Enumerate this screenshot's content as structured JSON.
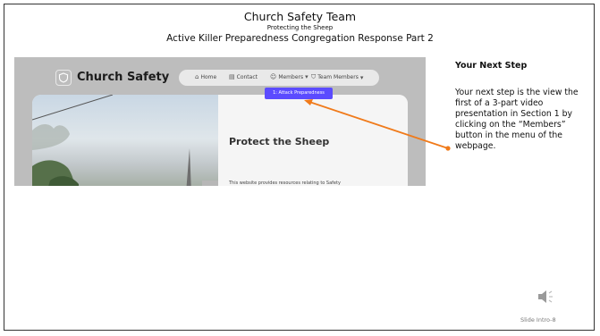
{
  "slide": {
    "title": "Church Safety Team",
    "subtitle": "Protecting the Sheep",
    "heading": "Active Killer Preparedness Congregation Response Part 2",
    "slide_number": "Slide Intro-8"
  },
  "website": {
    "brand": "Church Safety",
    "nav": {
      "home": "Home",
      "contact": "Contact",
      "members": "Members",
      "team_members": "Team Members"
    },
    "dropdown_item": "1: Attack Preparedness",
    "hero_title": "Protect the Sheep",
    "hero_text": "This website provides resources relating to Safety"
  },
  "callout": {
    "heading": "Your Next Step",
    "body": "Your next step is the view the first of a 3-part video presentation in Section 1 by clicking on the “Members” button in the menu of the webpage."
  },
  "colors": {
    "accent": "#5b4bff",
    "arrow": "#f07a1a"
  },
  "icons": [
    "shield-icon",
    "home-icon",
    "contact-icon",
    "members-icon",
    "team-members-icon",
    "chevron-down-icon",
    "speaker-icon"
  ]
}
